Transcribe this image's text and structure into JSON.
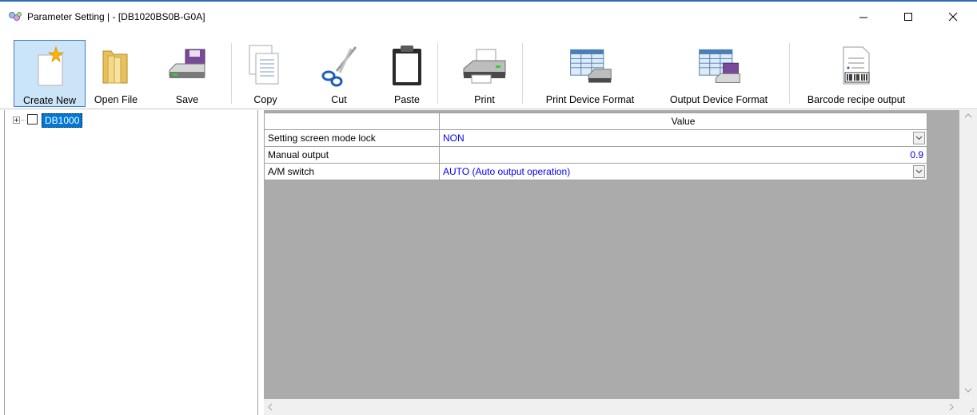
{
  "window": {
    "title": "Parameter Setting |  - [DB1020BS0B-G0A]",
    "controls": {
      "minimize": "—",
      "maximize": "☐",
      "close": "✕"
    }
  },
  "toolbar": {
    "items": [
      {
        "label": "Create New",
        "icon": "new-document-icon",
        "active": true
      },
      {
        "label": "Open File",
        "icon": "folder-icon"
      },
      {
        "label": "Save",
        "icon": "save-drive-icon"
      },
      {
        "label": "Copy",
        "icon": "copy-icon"
      },
      {
        "label": "Cut",
        "icon": "scissors-icon"
      },
      {
        "label": "Paste",
        "icon": "clipboard-icon"
      },
      {
        "label": "Print",
        "icon": "printer-icon"
      },
      {
        "label": "Print Device Format",
        "icon": "print-format-icon"
      },
      {
        "label": "Output Device Format",
        "icon": "output-format-icon"
      },
      {
        "label": "Barcode recipe output",
        "icon": "barcode-icon"
      }
    ]
  },
  "tree": {
    "root": {
      "label": "DB1000",
      "checked": false,
      "expanded": false
    }
  },
  "grid": {
    "header": {
      "name": "",
      "value": "Value"
    },
    "rows": [
      {
        "name": "Setting screen mode lock",
        "value": "NON",
        "type": "combo"
      },
      {
        "name": "Manual output",
        "value": "0.9",
        "type": "number"
      },
      {
        "name": "A/M switch",
        "value": "AUTO (Auto output operation)",
        "type": "combo"
      }
    ]
  },
  "colors": {
    "accent": "#2b6cb5",
    "selection": "#0078d7",
    "value_text": "#0000ff",
    "grid_background": "#ababab"
  }
}
